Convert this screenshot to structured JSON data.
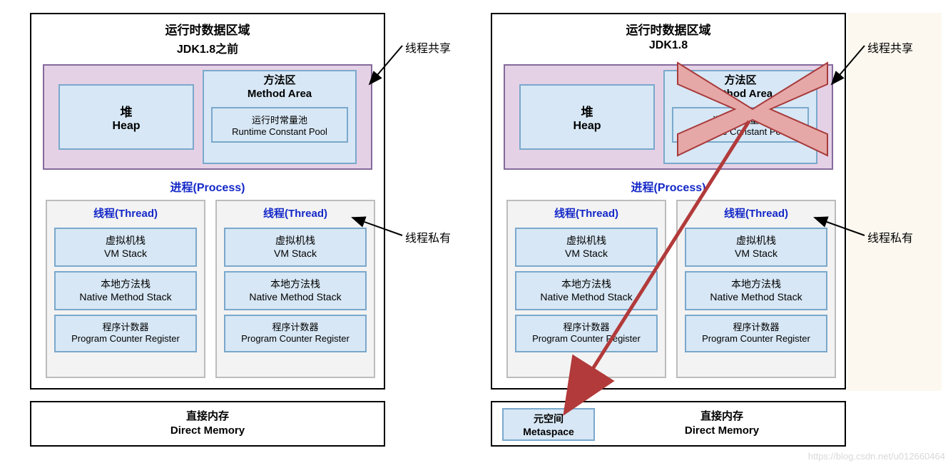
{
  "left": {
    "title": "运行时数据区域",
    "subtitle": "JDK1.8之前",
    "heap_cn": "堆",
    "heap_en": "Heap",
    "method_cn": "方法区",
    "method_en": "Method Area",
    "rcp_cn": "运行时常量池",
    "rcp_en": "Runtime Constant Pool",
    "proc": "进程(Process)",
    "thread": "线程(Thread)",
    "vm_cn": "虚拟机栈",
    "vm_en": "VM Stack",
    "nm_cn": "本地方法栈",
    "nm_en": "Native Method Stack",
    "pc_cn": "程序计数器",
    "pc_en": "Program Counter Register",
    "direct_cn": "直接内存",
    "direct_en": "Direct Memory"
  },
  "right": {
    "title": "运行时数据区域",
    "subtitle": "JDK1.8",
    "heap_cn": "堆",
    "heap_en": "Heap",
    "method_cn": "方法区",
    "method_en": "Method Area",
    "rcp_cn": "运行时常量池",
    "rcp_en": "Runtime Constant Pool",
    "proc": "进程(Process)",
    "thread": "线程(Thread)",
    "vm_cn": "虚拟机栈",
    "vm_en": "VM Stack",
    "nm_cn": "本地方法栈",
    "nm_en": "Native Method Stack",
    "pc_cn": "程序计数器",
    "pc_en": "Program Counter Register",
    "metaspace_cn": "元空间",
    "metaspace_en": "Metaspace",
    "direct_cn": "直接内存",
    "direct_en": "Direct Memory"
  },
  "annot": {
    "shared": "线程共享",
    "private": "线程私有"
  },
  "watermark": "https://blog.csdn.net/u012660464",
  "colors": {
    "purple_fill": "#e5d1e6",
    "purple_border": "#846a9b",
    "blue_fill": "#d7e7f5",
    "blue_border": "#7aa8cc",
    "grey_fill": "#f3f3f3",
    "grey_border": "#bcbcbc",
    "link_blue": "#1428c8",
    "x_fill": "#e6a7a7",
    "x_border": "#a83a3a",
    "arrow_red": "#b23a3a"
  }
}
